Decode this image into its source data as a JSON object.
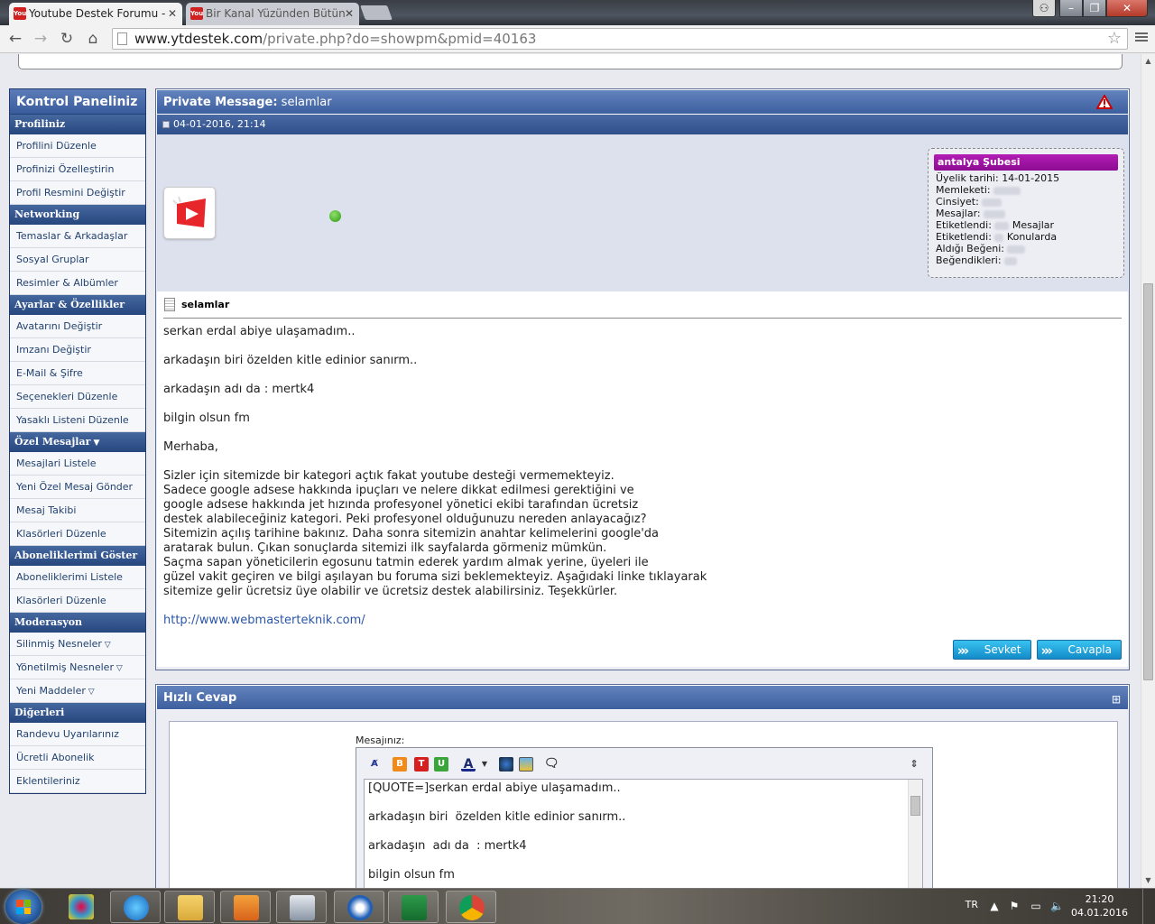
{
  "browser": {
    "tabs": [
      {
        "title": "Youtube Destek Forumu -",
        "favicon": "youtube-icon"
      },
      {
        "title": "Bir Kanal Yüzünden Bütün",
        "favicon": "youtube-icon"
      }
    ],
    "url_host": "www.ytdestek.com",
    "url_path": "/private.php?do=showpm&pmid=40163"
  },
  "sidebar": {
    "title": "Kontrol Paneliniz",
    "sections": [
      {
        "heading": "Profiliniz",
        "items": [
          "Profilini Düzenle",
          "Profinizi Özelleştirin",
          "Profil Resmini Değiştir"
        ]
      },
      {
        "heading": "Networking",
        "items": [
          "Temaslar & Arkadaşlar",
          "Sosyal Gruplar",
          "Resimler & Albümler"
        ]
      },
      {
        "heading": "Ayarlar & Özellikler",
        "items": [
          "Avatarını Değiştir",
          "Imzanı Değiştir",
          "E-Mail & Şifre",
          "Seçenekleri Düzenle",
          "Yasaklı Listeni Düzenle"
        ]
      },
      {
        "heading": "Özel Mesajlar",
        "items": [
          "Mesajlari Listele",
          "Yeni Özel Mesaj Gönder",
          "Mesaj Takibi",
          "Klasörleri Düzenle"
        ]
      },
      {
        "heading": "Aboneliklerimi Göster",
        "items": [
          "Aboneliklerimi Listele",
          "Klasörleri Düzenle"
        ]
      },
      {
        "heading": "Moderasyon",
        "items": [
          "Silinmiş Nesneler",
          "Yönetilmiş Nesneler",
          "Yeni Maddeler"
        ]
      },
      {
        "heading": "Diğerleri",
        "items": [
          "Randevu Uyarılarınız",
          "Ücretli Abonelik",
          "Eklentileriniz"
        ]
      }
    ]
  },
  "pm": {
    "header_label": "Private Message:",
    "header_subject": "selamlar",
    "date": "04-01-2016, 21:14",
    "user": {
      "name": "antalya Şubesi",
      "fields": [
        {
          "label": "Üyelik tarihi:",
          "value": "14-01-2015"
        },
        {
          "label": "Memleketi:",
          "value": ""
        },
        {
          "label": "Cinsiyet:",
          "value": ""
        },
        {
          "label": "Mesajlar:",
          "value": ""
        },
        {
          "label": "Etiketlendi:",
          "value": "Mesajlar"
        },
        {
          "label": "Etiketlendi:",
          "value": "Konularda"
        },
        {
          "label": "Aldığı Beğeni:",
          "value": ""
        },
        {
          "label": "Beğendikleri:",
          "value": ""
        }
      ]
    },
    "title": "selamlar",
    "body_lines": [
      "serkan erdal abiye ulaşamadım..",
      "",
      "arkadaşın biri özelden kitle edinior sanırm..",
      "",
      "arkadaşın adı da : mertk4",
      "",
      "bilgin olsun fm",
      "",
      "Merhaba,",
      "",
      "Sizler için sitemizde bir kategori açtık fakat youtube desteği vermemekteyiz.",
      "Sadece google adsese hakkında ipuçları ve nelere dikkat edilmesi gerektiğini ve",
      "google adsese hakkında jet hızında profesyonel yönetici ekibi tarafından ücretsiz",
      "destek alabileceğiniz kategori. Peki profesyonel olduğunuzu nereden anlayacağız?",
      "Sitemizin açılış tarihine bakınız. Daha sonra sitemizin anahtar kelimelerini google'da",
      "aratarak bulun. Çıkan sonuçlarda sitemizi ilk sayfalarda görmeniz mümkün.",
      "Saçma sapan yöneticilerin egosunu tatmin ederek yardım almak yerine, üyeleri ile",
      "güzel vakit geçiren ve bilgi aşılayan bu foruma sizi beklemekteyiz. Aşağıdaki linke tıklayarak",
      "sitemize gelir ücretsiz üye olabilir ve ücretsiz destek alabilirsiniz. Teşekkürler.",
      ""
    ],
    "link": "http://www.webmasterteknik.com/",
    "forward_label": "Sevket",
    "reply_label": "Cavapla"
  },
  "quick_reply": {
    "title": "Hızlı Cevap",
    "label": "Mesajınız:",
    "editor_lines": [
      "[QUOTE=]serkan erdal abiye ulaşamadım..",
      "",
      "arkadaşın biri  özelden kitle edinior sanırm..",
      "",
      "arkadaşın  adı da  : mertk4",
      "",
      "bilgin olsun fm"
    ],
    "toolbar_icons": [
      "remove-format-icon",
      "bold-icon",
      "italic-icon",
      "underline-icon",
      "font-color-icon",
      "insert-link-icon",
      "insert-image-icon",
      "quote-icon"
    ]
  },
  "taskbar": {
    "apps": [
      "paint-icon",
      "internet-explorer-icon",
      "file-explorer-icon",
      "media-player-icon",
      "calculator-icon",
      "ccleaner-icon",
      "excel-icon",
      "chrome-icon"
    ],
    "lang": "TR",
    "time": "21:20",
    "date": "04.01.2016"
  },
  "colors": {
    "header_blue": "#3d5f9e",
    "username_purple": "#a016a3",
    "link_blue": "#2a56a8",
    "button_cyan": "#1fa3dc"
  }
}
